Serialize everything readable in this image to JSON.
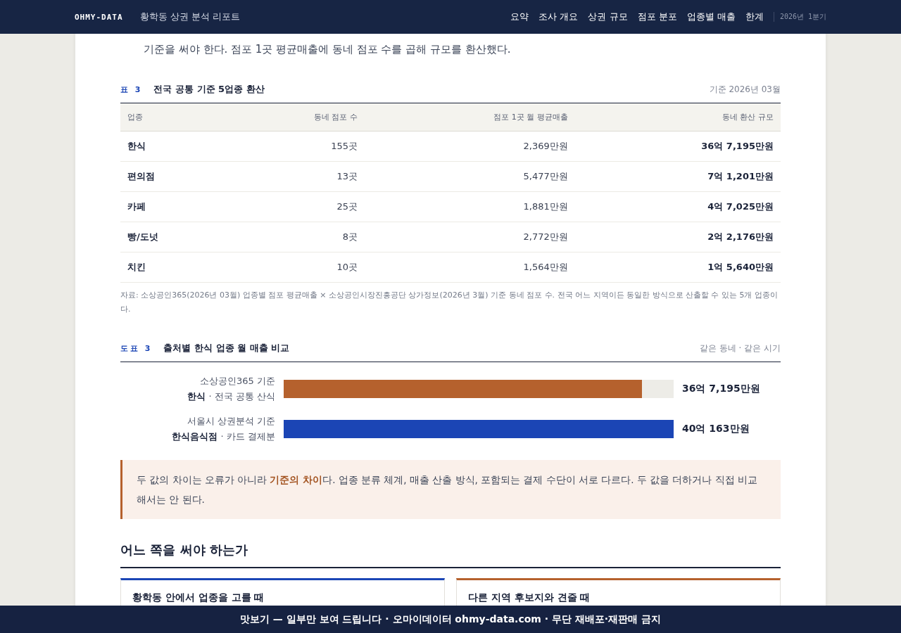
{
  "header": {
    "logo": "OHMY-DATA",
    "report_title": "황학동 상권 분석 리포트",
    "nav": [
      {
        "label": "요약",
        "selected": false
      },
      {
        "label": "조사 개요",
        "selected": false
      },
      {
        "label": "상권 규모",
        "selected": false
      },
      {
        "label": "점포 분포",
        "selected": false
      },
      {
        "label": "업종별 매출",
        "selected": false
      },
      {
        "label": "한계",
        "selected": false
      }
    ],
    "period": "2026년 1분기"
  },
  "intro_tail": "기준을 써야 한다. 점포 1곳 평균매출에 동네 점포 수를 곱해 규모를 환산했다.",
  "table": {
    "tag": "표 3",
    "title": "전국 공통 기준 5업종 환산",
    "note": "기준 2026년 03월",
    "columns": [
      "업종",
      "동네 점포 수",
      "점포 1곳 월 평균매출",
      "동네 환산 규모"
    ],
    "rows": [
      [
        "한식",
        "155곳",
        "2,369만원",
        "36억 7,195만원"
      ],
      [
        "편의점",
        "13곳",
        "5,477만원",
        "7억 1,201만원"
      ],
      [
        "카페",
        "25곳",
        "1,881만원",
        "4억 7,025만원"
      ],
      [
        "빵/도넛",
        "8곳",
        "2,772만원",
        "2억 2,176만원"
      ],
      [
        "치킨",
        "10곳",
        "1,564만원",
        "1억 5,640만원"
      ]
    ],
    "source": "자료: 소상공인365(2026년 03월) 업종별 점포 평균매출 × 소상공인시장진흥공단 상가정보(2026년 3월) 기준 동네 점포 수. 전국 어느 지역이든 동일한 방식으로 산출할 수 있는 5개 업종이다."
  },
  "figure": {
    "tag": "도표 3",
    "title": "출처별 한식 업종 월 매출 비교",
    "note": "같은 동네 · 같은 시기",
    "bars": [
      {
        "source": "소상공인365 기준",
        "category": "**한식** · 전국 공통 산식",
        "level": 0.918,
        "color": "#b5612d",
        "reading": "36억 7,195만원"
      },
      {
        "source": "서울시 상권분석 기준",
        "category": "**한식음식점** · 카드 결제분",
        "level": 1,
        "color": "#1b45b5",
        "reading": "40억 163만원"
      }
    ]
  },
  "callout": "두 값의 차이는 오류가 아니라 **기준의 차이**다. 업종 분류 체계, 매출 산출 방식, 포함되는 결제 수단이 서로 다르다. 두 값을 더하거나 직접 비교해서는 안 된다.",
  "section_title": "어느 쪽을 써야 하는가",
  "cards": [
    {
      "title": "황학동 안에서 업종을 고를 때",
      "color": "#1b45b5"
    },
    {
      "title": "다른 지역 후보지와 견줄 때",
      "color": "#b5612d"
    }
  ],
  "footer_banner": "맛보기 — 일부만 보여 드립니다 · 오마이데이터 ohmy-data.com · 무단 재배포·재판매 금지"
}
